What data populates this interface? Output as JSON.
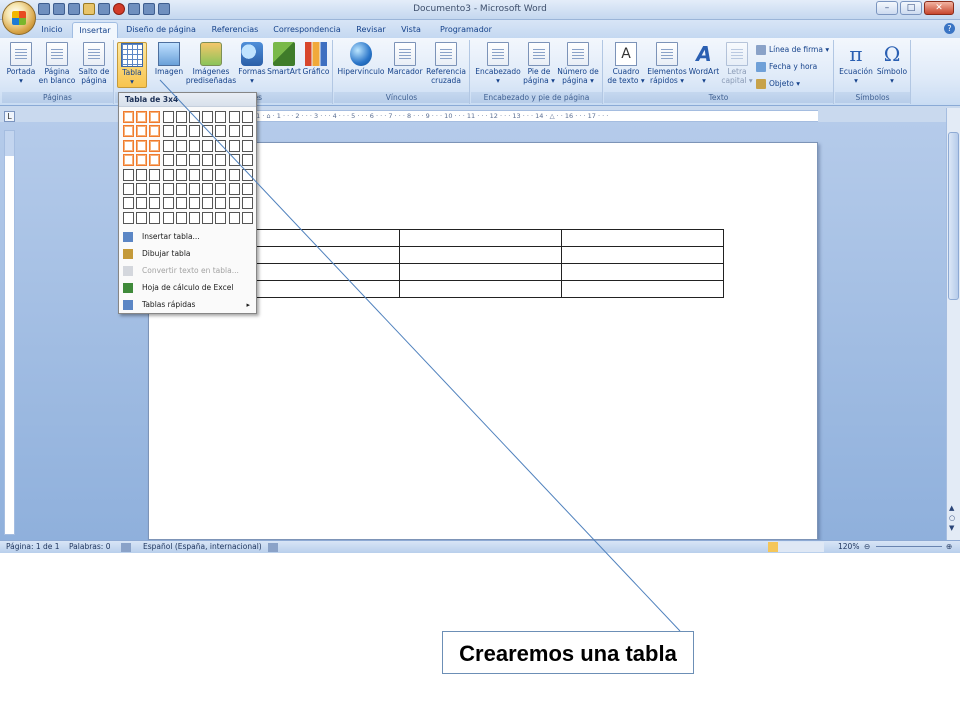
{
  "window": {
    "title": "Documento3 - Microsoft Word",
    "min_label": "–",
    "max_label": "□",
    "close_label": "✕",
    "help_label": "?"
  },
  "tabs": [
    {
      "label": "Inicio"
    },
    {
      "label": "Insertar",
      "active": true
    },
    {
      "label": "Diseño de página"
    },
    {
      "label": "Referencias"
    },
    {
      "label": "Correspondencia"
    },
    {
      "label": "Revisar"
    },
    {
      "label": "Vista"
    },
    {
      "label": "Programador"
    }
  ],
  "ribbon": {
    "groups": {
      "paginas": {
        "label": "Páginas"
      },
      "ilustraciones": {
        "label": "es"
      },
      "vinculos": {
        "label": "Vínculos"
      },
      "encabezado": {
        "label": "Encabezado y pie de página"
      },
      "texto": {
        "label": "Texto"
      },
      "simbolos": {
        "label": "Símbolos"
      }
    },
    "buttons": {
      "portada": {
        "line1": "Portada",
        "line2": "▾",
        "icon": "cover-page-icon"
      },
      "pagina_blanco": {
        "line1": "Página",
        "line2": "en blanco",
        "icon": "blank-page-icon"
      },
      "salto_pagina": {
        "line1": "Salto de",
        "line2": "página",
        "icon": "page-break-icon"
      },
      "tabla": {
        "line1": "Tabla",
        "line2": "▾",
        "icon": "table-icon"
      },
      "imagen": {
        "line1": "Imagen",
        "line2": "",
        "icon": "picture-icon"
      },
      "imagenes_prediseñadas": {
        "line1": "Imágenes",
        "line2": "prediseñadas",
        "icon": "clip-art-icon"
      },
      "formas": {
        "line1": "Formas",
        "line2": "▾",
        "icon": "shapes-icon"
      },
      "smartart": {
        "line1": "SmartArt",
        "line2": "",
        "icon": "smartart-icon"
      },
      "grafico": {
        "line1": "Gráfico",
        "line2": "",
        "icon": "chart-icon"
      },
      "hipervinculo": {
        "line1": "Hipervínculo",
        "line2": "",
        "icon": "hyperlink-globe-icon"
      },
      "marcador": {
        "line1": "Marcador",
        "line2": "",
        "icon": "bookmark-icon"
      },
      "referencia_cruzada": {
        "line1": "Referencia",
        "line2": "cruzada",
        "icon": "cross-reference-icon"
      },
      "encabezado": {
        "line1": "Encabezado",
        "line2": "▾",
        "icon": "header-icon"
      },
      "pie_pagina": {
        "line1": "Pie de",
        "line2": "página ▾",
        "icon": "footer-icon"
      },
      "numero_pagina": {
        "line1": "Número de",
        "line2": "página ▾",
        "icon": "page-number-icon"
      },
      "cuadro_texto": {
        "line1": "Cuadro",
        "line2": "de texto ▾",
        "icon": "text-box-icon"
      },
      "elementos_rapidos": {
        "line1": "Elementos",
        "line2": "rápidos ▾",
        "icon": "quick-parts-icon"
      },
      "wordart": {
        "line1": "WordArt",
        "line2": "▾",
        "icon": "wordart-icon"
      },
      "letra_capital": {
        "line1": "Letra",
        "line2": "capital ▾",
        "icon": "drop-cap-icon"
      },
      "ecuacion": {
        "line1": "Ecuación",
        "line2": "▾",
        "icon": "equation-icon"
      },
      "simbolo": {
        "line1": "Símbolo",
        "line2": "▾",
        "icon": "omega-icon"
      }
    },
    "small_buttons": {
      "linea_firma": "Línea de firma ▾",
      "fecha_hora": "Fecha y hora",
      "objeto": "Objeto ▾"
    },
    "glyphs": {
      "wordart": "A",
      "equation": "π",
      "symbol": "Ω",
      "textbox": "A"
    }
  },
  "ruler": {
    "tab_selector": "L",
    "marks": "· 1 · ⌂ · 1 · · · 2 · · · 3 · · · 4 · · · 5 · · · 6 · · · 7 · · · 8 · · · 9 · · · 10 · · · 11 · · · 12 · · · 13 · · · 14 · △ · · 16 · · · 17 · · ·"
  },
  "table_menu": {
    "header": "Tabla de 3x4",
    "grid_cols": 10,
    "grid_rows": 8,
    "selected_cols": 3,
    "selected_rows": 4,
    "items": [
      {
        "label": "Insertar tabla...",
        "icon": "insert-table-icon",
        "enabled": true
      },
      {
        "label": "Dibujar tabla",
        "icon": "draw-table-icon",
        "enabled": true
      },
      {
        "label": "Convertir texto en tabla...",
        "icon": "convert-text-icon",
        "enabled": false
      },
      {
        "label": "Hoja de cálculo de Excel",
        "icon": "excel-sheet-icon",
        "enabled": true
      },
      {
        "label": "Tablas rápidas",
        "icon": "quick-tables-icon",
        "enabled": true,
        "submenu": "▸"
      }
    ]
  },
  "document": {
    "table_rows": 4,
    "table_cols": 3
  },
  "statusbar": {
    "page": "Página: 1 de 1",
    "words": "Palabras: 0",
    "language": "Español (España, internacional)",
    "zoom": "120%",
    "zoom_minus": "⊖",
    "zoom_plus": "⊕"
  },
  "callout": {
    "text": "Crearemos una tabla"
  },
  "colors": {
    "ribbon_bg": "#dfeaf8",
    "grid_selected": "#ef7b2f",
    "callout_line": "#4f81bd"
  }
}
